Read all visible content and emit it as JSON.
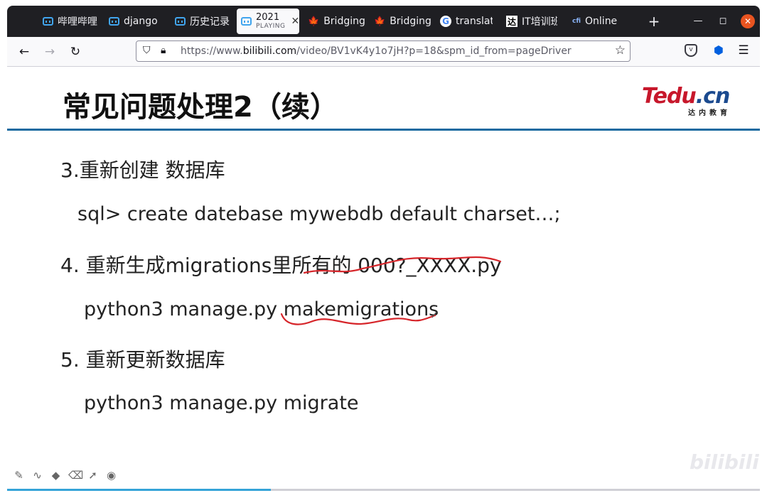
{
  "tabs": [
    {
      "label": "哔哩哔哩",
      "icon": "bilibili-icon"
    },
    {
      "label": "django",
      "icon": "bilibili-icon"
    },
    {
      "label": "历史记录",
      "icon": "bilibili-icon"
    },
    {
      "label": "2021",
      "sub": "PLAYING",
      "icon": "bilibili-icon",
      "active": true
    },
    {
      "label": "Bridging",
      "icon": "maple-leaf-icon"
    },
    {
      "label": "Bridging",
      "icon": "maple-leaf-icon"
    },
    {
      "label": "translate",
      "icon": "google-icon"
    },
    {
      "label": "IT培训班",
      "icon": "tedu-icon"
    },
    {
      "label": "Online",
      "icon": "cfi-icon"
    }
  ],
  "url": {
    "prefix": "https://www.",
    "host": "bilibili.com",
    "path": "/video/BV1vK4y1o7jH?p=18&spm_id_from=pageDriver"
  },
  "slide": {
    "title": "常见问题处理2（续）",
    "logo_text": "Tedu.cn",
    "logo_sub": "达内教育",
    "lines": [
      "3.重新创建 数据库",
      "sql> create datebase mywebdb default charset…;",
      "4. 重新生成migrations里所有的 000?_XXXX.py",
      "python3 manage.py makemigrations",
      "5. 重新更新数据库",
      "python3 manage.py migrate"
    ],
    "watermark": "bilibili"
  },
  "video": {
    "progress": 0.35
  },
  "colors": {
    "accent": "#1a6aa0",
    "progress": "#35a4d8",
    "annotation": "#d6252a"
  }
}
